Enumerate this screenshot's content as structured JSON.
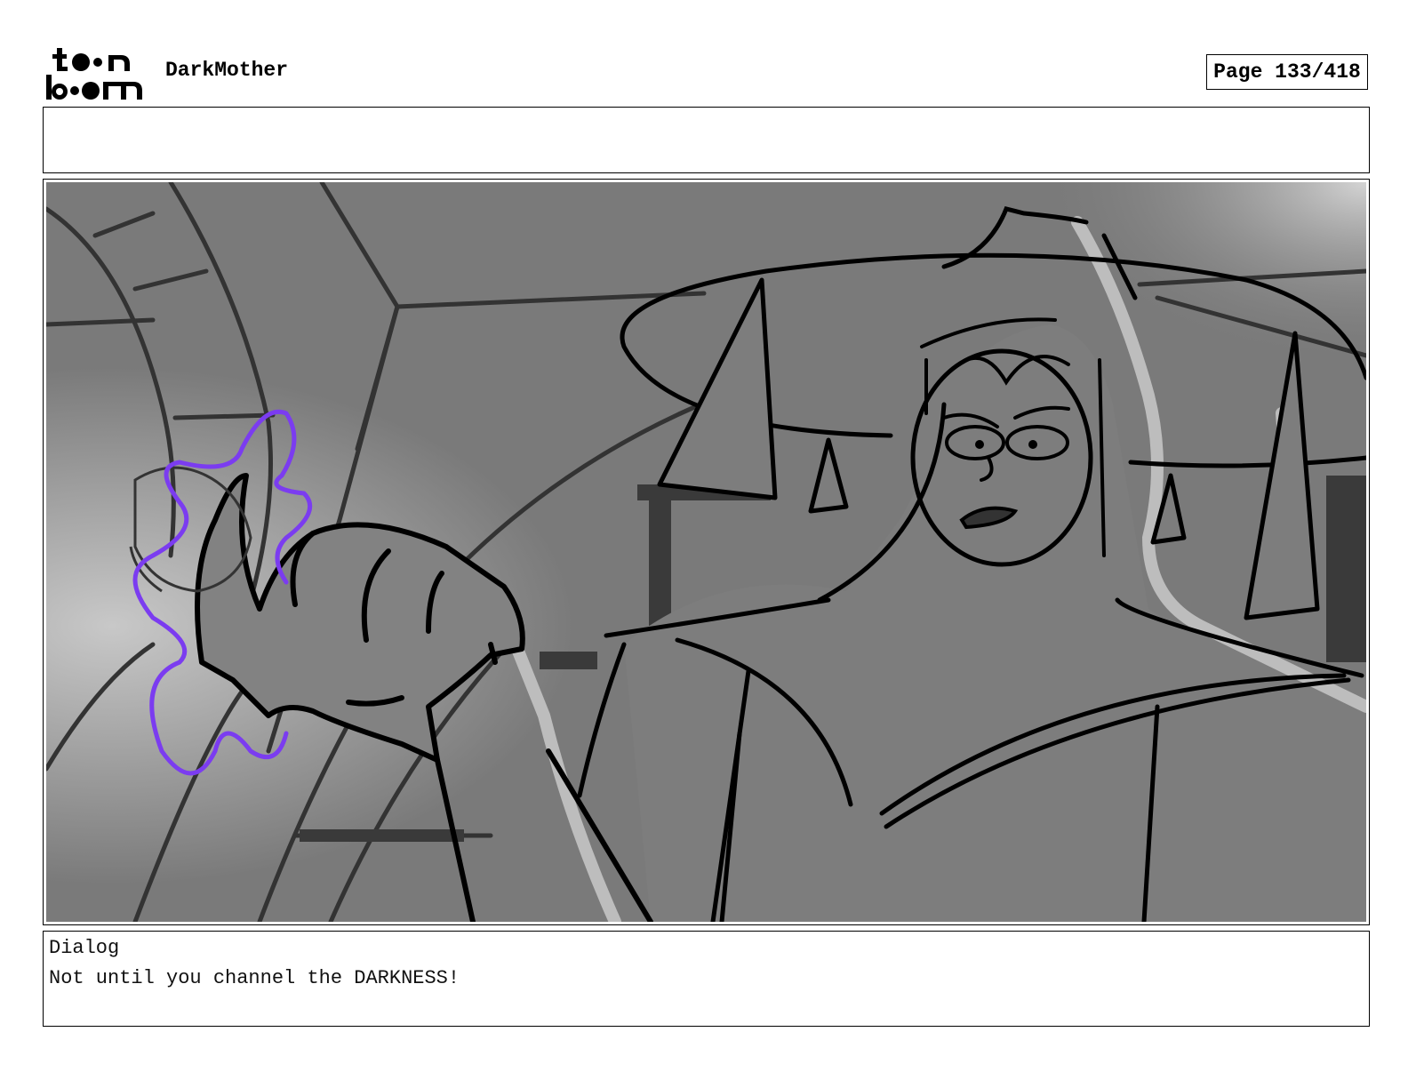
{
  "header": {
    "logo_text_top": "toon",
    "logo_text_bottom": "boom",
    "project_title": "DarkMother",
    "page_indicator": "Page 133/418"
  },
  "panel": {
    "description_icon": "storyboard-sketch",
    "accent_color": "#7b3cf0"
  },
  "dialog": {
    "label": "Dialog",
    "text": "Not until you channel the DARKNESS!"
  }
}
